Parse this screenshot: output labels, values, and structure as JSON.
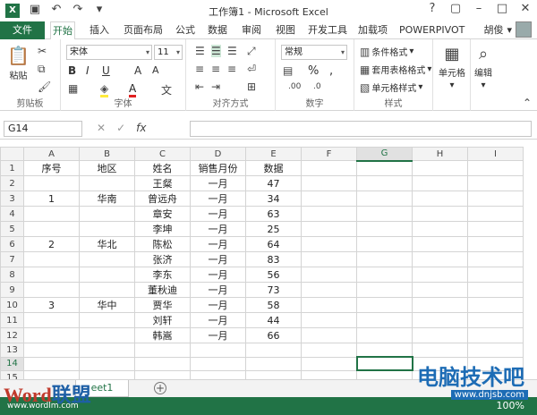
{
  "title": "工作簿1 - Microsoft Excel",
  "qat_icons": [
    "save-icon",
    "undo-icon",
    "redo-icon"
  ],
  "window_controls": [
    "?",
    "▢",
    "–",
    "□",
    "✕"
  ],
  "tabs": [
    "文件",
    "开始",
    "插入",
    "页面布局",
    "公式",
    "数据",
    "审阅",
    "视图",
    "开发工具",
    "加载项",
    "POWERPIVOT"
  ],
  "user": "胡俊",
  "ribbon": {
    "clipboard": {
      "label": "剪贴板",
      "paste": "粘贴"
    },
    "font": {
      "label": "字体",
      "name": "宋体",
      "size": "11"
    },
    "alignment": {
      "label": "对齐方式"
    },
    "number": {
      "label": "数字",
      "format": "常规"
    },
    "styles": {
      "label": "样式",
      "conditional": "条件格式",
      "table": "套用表格格式",
      "cell": "单元格样式"
    },
    "cells": {
      "label": "单元格"
    },
    "editing": {
      "label": "编辑"
    }
  },
  "namebox": "G14",
  "columns": [
    "A",
    "B",
    "C",
    "D",
    "E",
    "F",
    "G",
    "H",
    "I"
  ],
  "rows": [
    [
      "序号",
      "地区",
      "姓名",
      "销售月份",
      "数据"
    ],
    [
      "",
      "",
      "王粲",
      "一月",
      "47"
    ],
    [
      "1",
      "华南",
      "曾远舟",
      "一月",
      "34"
    ],
    [
      "",
      "",
      "章安",
      "一月",
      "63"
    ],
    [
      "",
      "",
      "李坤",
      "一月",
      "25"
    ],
    [
      "2",
      "华北",
      "陈松",
      "一月",
      "64"
    ],
    [
      "",
      "",
      "张济",
      "一月",
      "83"
    ],
    [
      "",
      "",
      "李东",
      "一月",
      "56"
    ],
    [
      "",
      "",
      "董秋迪",
      "一月",
      "73"
    ],
    [
      "3",
      "华中",
      "贾华",
      "一月",
      "58"
    ],
    [
      "",
      "",
      "刘轩",
      "一月",
      "44"
    ],
    [
      "",
      "",
      "韩嵩",
      "一月",
      "66"
    ],
    [
      "",
      "",
      "",
      "",
      ""
    ],
    [
      "",
      "",
      "",
      "",
      ""
    ],
    [
      "",
      "",
      "",
      "",
      ""
    ],
    [
      "",
      "",
      "",
      "",
      ""
    ]
  ],
  "sheet_tab": "eet1",
  "zoom": "100%",
  "watermarks": {
    "left_a": "Word",
    "left_b": "联盟",
    "left_url": "www.wordlm.com",
    "right": "电脑技术吧",
    "right_url": "www.dnjsb.com"
  },
  "colors": {
    "accent": "#217346"
  }
}
